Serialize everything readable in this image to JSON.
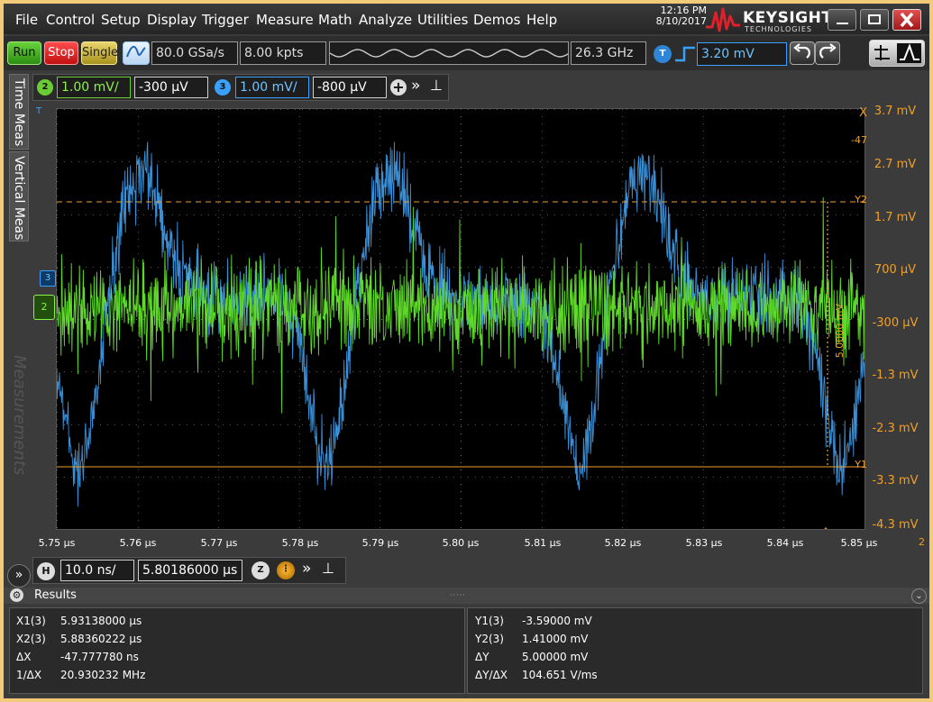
{
  "menu": [
    "File",
    "Control",
    "Setup",
    "Display",
    "Trigger",
    "Measure",
    "Math",
    "Analyze",
    "Utilities",
    "Demos",
    "Help"
  ],
  "clock": {
    "time": "12:16 PM",
    "date": "8/10/2017"
  },
  "brand": {
    "name": "KEYSIGHT",
    "tagline": "TECHNOLOGIES"
  },
  "toolbar": {
    "run_label": "Run",
    "stop_label": "Stop",
    "single_label": "Single",
    "sample_rate": "80.0 GSa/s",
    "memory_depth": "8.00 kpts",
    "bandwidth": "26.3 GHz",
    "trigger_badge": "T",
    "trigger_level": "3.20 mV"
  },
  "channels": [
    {
      "badge": "2",
      "scale": "1.00 mV/",
      "offset": "-300 µV",
      "color": "#6acb34"
    },
    {
      "badge": "3",
      "scale": "1.00 mV/",
      "offset": "-800 µV",
      "color": "#3aa0ff"
    }
  ],
  "side_tabs": [
    "Time Meas",
    "Vertical Meas"
  ],
  "watermark": "Measurements",
  "screen": {
    "y_labels": [
      "3.7 mV",
      "2.7 mV",
      "1.7 mV",
      "700 µV",
      "-300 µV",
      "-1.3 mV",
      "-2.3 mV",
      "-3.3 mV",
      "-4.3 mV"
    ],
    "x_labels": [
      "5.75 µs",
      "5.76 µs",
      "5.77 µs",
      "5.78 µs",
      "5.79 µs",
      "5.80 µs",
      "5.81 µs",
      "5.82 µs",
      "5.83 µs",
      "5.84 µs",
      "5.85 µs"
    ],
    "x_marker": "X",
    "x_marker_value": "-47",
    "y2_marker": "Y2",
    "y1_marker": "Y1",
    "delta_label": "5.0000 mV",
    "trigger_marker": "T",
    "axis_suffix": "2",
    "colors": {
      "ch2": "#5fd92a",
      "ch3": "#3b8fd6",
      "marker": "#f0a02a"
    }
  },
  "horizontal": {
    "badge": "H",
    "scale": "10.0 ns/",
    "position": "5.80186000 µs"
  },
  "results": {
    "title": "Results",
    "left": [
      {
        "label": "X1(3)",
        "value": "5.93138000 µs"
      },
      {
        "label": "X2(3)",
        "value": "5.88360222 µs"
      },
      {
        "label": "ΔX",
        "value": "-47.777780 ns"
      },
      {
        "label": "1/ΔX",
        "value": "20.930232 MHz"
      }
    ],
    "right": [
      {
        "label": "Y1(3)",
        "value": "-3.59000 mV"
      },
      {
        "label": "Y2(3)",
        "value": "1.41000 mV"
      },
      {
        "label": "ΔY",
        "value": "5.00000 mV"
      },
      {
        "label": "ΔY/ΔX",
        "value": "104.651 V/ms"
      }
    ]
  }
}
